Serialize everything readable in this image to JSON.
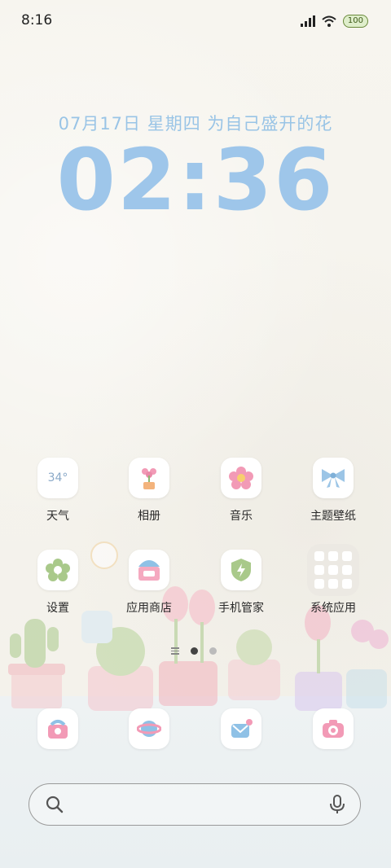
{
  "status": {
    "time": "8:16",
    "battery": "100"
  },
  "lockscreen": {
    "date": "07月17日 星期四 为自己盛开的花",
    "clock": "02:36"
  },
  "apps_row1": [
    {
      "label": "天气",
      "icon": "weather-icon",
      "temp": "34°"
    },
    {
      "label": "相册",
      "icon": "gallery-icon"
    },
    {
      "label": "音乐",
      "icon": "music-icon"
    },
    {
      "label": "主题壁纸",
      "icon": "theme-icon"
    }
  ],
  "apps_row2": [
    {
      "label": "设置",
      "icon": "settings-icon"
    },
    {
      "label": "应用商店",
      "icon": "app-store-icon"
    },
    {
      "label": "手机管家",
      "icon": "security-icon"
    },
    {
      "label": "系统应用",
      "icon": "folder-icon"
    }
  ],
  "dock": [
    {
      "icon": "phone-icon"
    },
    {
      "icon": "browser-icon"
    },
    {
      "icon": "messages-icon"
    },
    {
      "icon": "camera-icon"
    }
  ],
  "pages": {
    "current": 2,
    "total": 3
  },
  "colors": {
    "clock": "#9ec6ea",
    "accent_pink": "#f29ab6",
    "accent_green": "#a9c98a"
  }
}
